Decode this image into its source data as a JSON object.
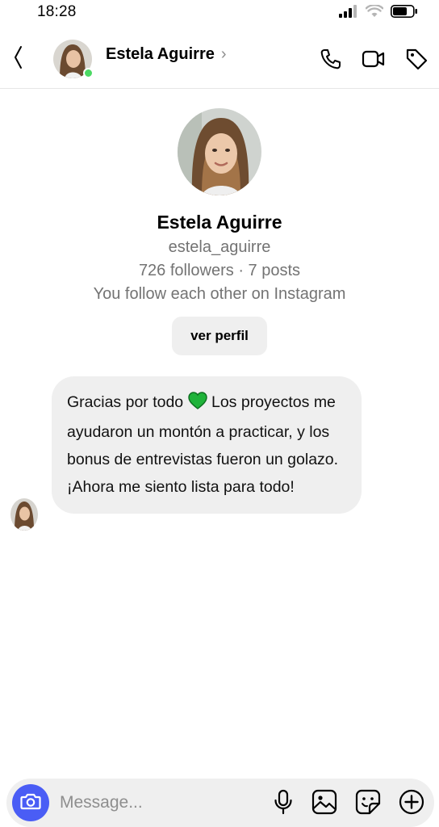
{
  "status_bar": {
    "time": "18:28"
  },
  "header": {
    "back_icon": "chevron-left-icon",
    "contact_name": "Estela Aguirre",
    "name_chevron": "›",
    "online": true,
    "actions": [
      "phone-icon",
      "video-camera-icon",
      "tag-icon"
    ]
  },
  "profile": {
    "name": "Estela Aguirre",
    "username": "estela_aguirre",
    "stats": "726 followers · 7 posts",
    "follow_status": "You follow each other on Instagram",
    "view_profile_label": "ver perfil"
  },
  "messages": [
    {
      "text_before": "Gracias por todo ",
      "emoji": "green-heart",
      "text_after": " Los proyectos me ayudaron un montón a practicar, y los bonus de entrevistas fueron un golazo. ¡Ahora me siento lista para todo!"
    }
  ],
  "composer": {
    "placeholder": "Message...",
    "actions": [
      "microphone-icon",
      "image-icon",
      "sticker-icon",
      "add-icon"
    ]
  },
  "colors": {
    "accent": "#4a5df5",
    "online": "#4cd964",
    "bubble": "#efefef",
    "secondary_text": "#737373"
  }
}
